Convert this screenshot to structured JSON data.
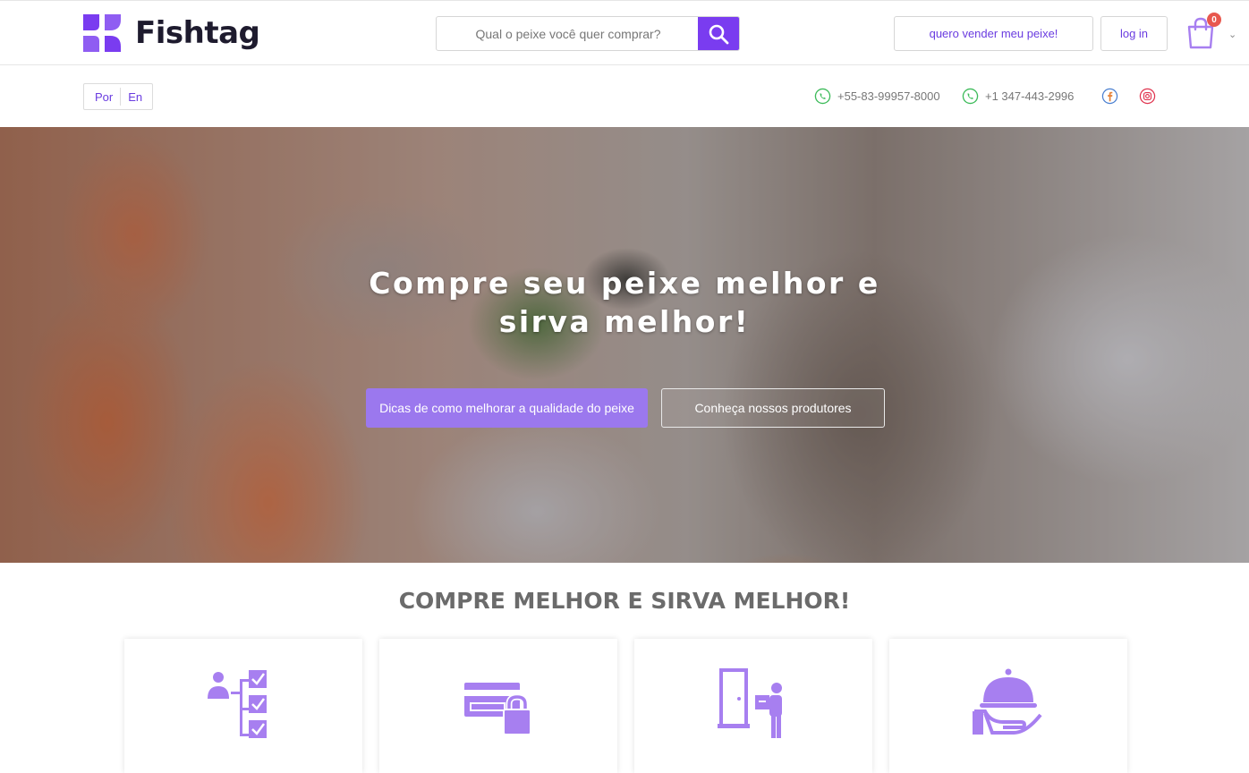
{
  "header": {
    "logo_text": "Fishtag",
    "search_placeholder": "Qual o peixe você quer comprar?",
    "sell_label": "quero vender meu peixe!",
    "login_label": "log in",
    "cart_count": "0"
  },
  "subbar": {
    "lang_pt": "Por",
    "lang_en": "En",
    "phone_br": "+55-83-99957-8000",
    "phone_us": "+1 347-443-2996"
  },
  "hero": {
    "title_line1": "Compre seu peixe melhor e",
    "title_line2": "sirva melhor!",
    "tips_button": "Dicas de como melhorar a qualidade do peixe",
    "producers_button": "Conheça nossos produtores"
  },
  "section": {
    "title": "COMPRE MELHOR E SIRVA MELHOR!"
  },
  "features": [
    {
      "icon": "checklist-icon"
    },
    {
      "icon": "secure-payment-icon"
    },
    {
      "icon": "delivery-door-icon"
    },
    {
      "icon": "serving-dish-icon"
    }
  ],
  "colors": {
    "brand": "#7a3cf0",
    "accent_light": "#9b78ee",
    "icon": "#a77ff0",
    "badge": "#e8584e"
  }
}
